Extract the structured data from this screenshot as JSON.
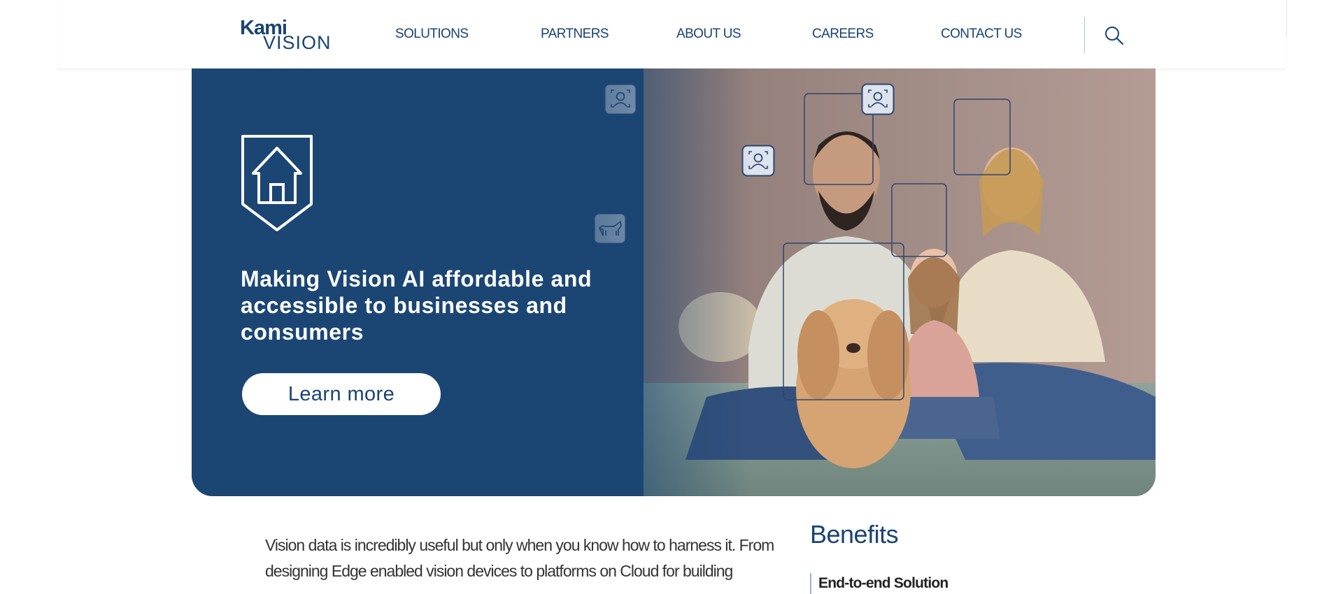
{
  "brand": {
    "logo_line1": "Kami",
    "logo_line2": "VISION",
    "color_primary": "#1a4372",
    "color_hero_bg": "#1b4674"
  },
  "nav": {
    "items": [
      {
        "label": "SOLUTIONS"
      },
      {
        "label": "PARTNERS"
      },
      {
        "label": "ABOUT US"
      },
      {
        "label": "CAREERS"
      },
      {
        "label": "CONTACT US"
      }
    ],
    "search_icon": "search-icon"
  },
  "hero": {
    "badge_icon": "home-shield-icon",
    "headline": "Making Vision AI affordable and accessible to businesses and consumers",
    "cta_label": "Learn more",
    "detection_icons": [
      "face-detect-icon",
      "face-detect-icon",
      "face-detect-icon",
      "pet-detect-icon"
    ]
  },
  "content": {
    "intro": "Vision data is incredibly useful but only when you know how to harness it. From designing Edge enabled vision devices to platforms on Cloud for building",
    "benefits_title": "Benefits",
    "benefits": [
      {
        "label": "End-to-end Solution"
      }
    ]
  }
}
